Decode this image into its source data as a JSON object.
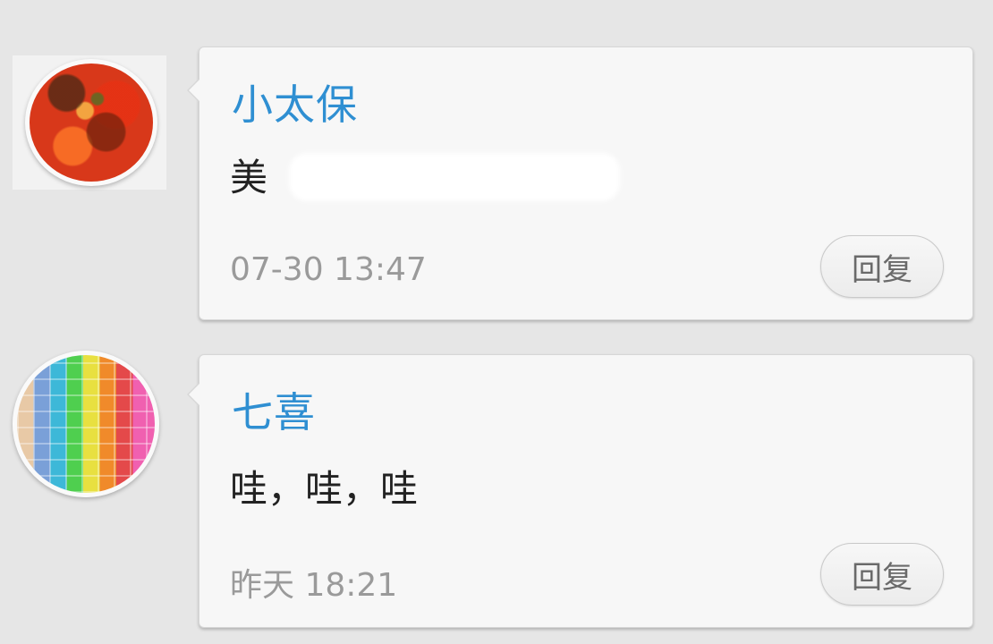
{
  "comments": [
    {
      "user": "小太保",
      "text": "美",
      "time": "07-30 13:47",
      "reply_label": "回复"
    },
    {
      "user": "七喜",
      "text": "哇，哇，哇",
      "time": "昨天 18:21",
      "reply_label": "回复"
    }
  ],
  "colors": {
    "username": "#2f8fd2",
    "timestamp": "#9a9a9a",
    "background": "#e6e6e6",
    "card": "#f7f7f7"
  }
}
